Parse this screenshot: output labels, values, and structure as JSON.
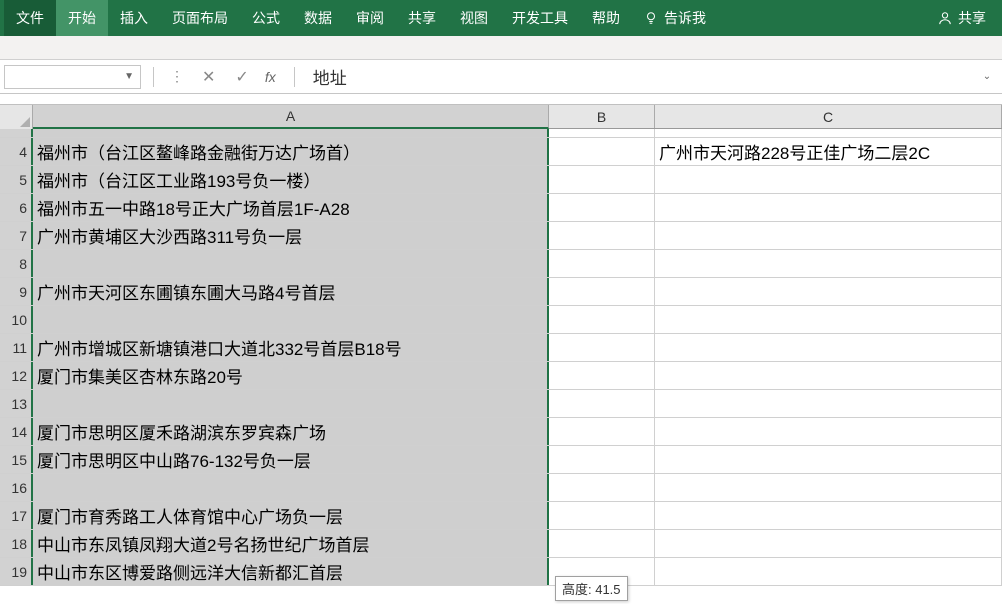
{
  "ribbon": {
    "tabs": [
      "文件",
      "开始",
      "插入",
      "页面布局",
      "公式",
      "数据",
      "审阅",
      "共享",
      "视图",
      "开发工具",
      "帮助"
    ],
    "tell_me": "告诉我",
    "share": "共享"
  },
  "formula_bar": {
    "name_box": "",
    "fx": "fx",
    "value": "地址"
  },
  "columns": [
    "A",
    "B",
    "C"
  ],
  "rows": [
    {
      "num": "",
      "partial": true,
      "A": "",
      "C": ""
    },
    {
      "num": "4",
      "A": "福州市（台江区鳌峰路金融街万达广场首）",
      "C": "广州市天河路228号正佳广场二层2C"
    },
    {
      "num": "5",
      "A": "福州市（台江区工业路193号负一楼）",
      "C": ""
    },
    {
      "num": "6",
      "A": "福州市五一中路18号正大广场首层1F-A28",
      "C": ""
    },
    {
      "num": "7",
      "A": "广州市黄埔区大沙西路311号负一层",
      "C": ""
    },
    {
      "num": "8",
      "A": "",
      "C": ""
    },
    {
      "num": "9",
      "A": "广州市天河区东圃镇东圃大马路4号首层",
      "C": ""
    },
    {
      "num": "10",
      "A": "",
      "C": ""
    },
    {
      "num": "11",
      "A": "广州市增城区新塘镇港口大道北332号首层B18号",
      "C": ""
    },
    {
      "num": "12",
      "A": "厦门市集美区杏林东路20号",
      "C": ""
    },
    {
      "num": "13",
      "A": "",
      "C": ""
    },
    {
      "num": "14",
      "A": "厦门市思明区厦禾路湖滨东罗宾森广场",
      "C": ""
    },
    {
      "num": "15",
      "A": "厦门市思明区中山路76-132号负一层",
      "C": ""
    },
    {
      "num": "16",
      "A": "",
      "C": ""
    },
    {
      "num": "17",
      "A": "厦门市育秀路工人体育馆中心广场负一层",
      "C": ""
    },
    {
      "num": "18",
      "A": "中山市东凤镇凤翔大道2号名扬世纪广场首层",
      "C": ""
    },
    {
      "num": "19",
      "A": "中山市东区博爱路侧远洋大信新都汇首层",
      "C": ""
    }
  ],
  "tooltip": "高度: 41.5"
}
